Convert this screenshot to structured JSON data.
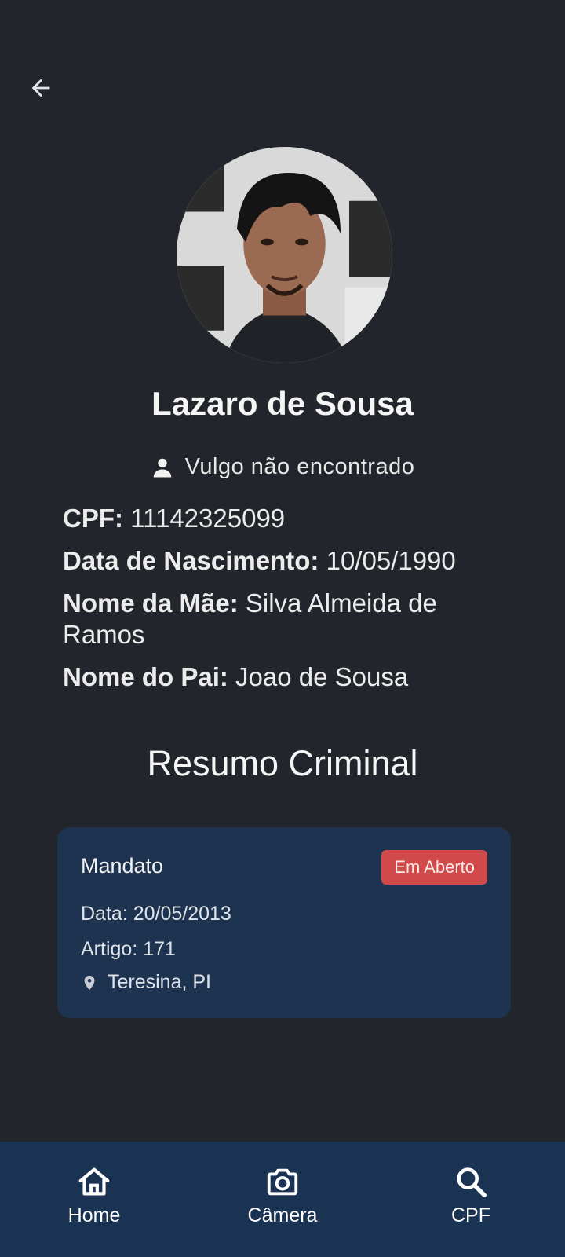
{
  "header": {
    "back_icon": "arrow-left-icon"
  },
  "profile": {
    "photo_icon": "profile-photo",
    "name": "Lazaro de Sousa",
    "nickname": "Vulgo não encontrado",
    "nickname_icon": "person-icon"
  },
  "details": [
    {
      "label": "CPF:",
      "value": " 11142325099"
    },
    {
      "label": "Data de Nascimento:",
      "value": " 10/05/1990"
    },
    {
      "label": "Nome da Mãe:",
      "value": " Silva Almeida de Ramos"
    },
    {
      "label": "Nome do Pai:",
      "value": " Joao de Sousa"
    }
  ],
  "summary": {
    "title": "Resumo Criminal",
    "records": [
      {
        "type": "Mandato",
        "status": "Em Aberto",
        "status_color": "#d04a4a",
        "date": "Data: 20/05/2013",
        "article": "Artigo: 171",
        "location": "Teresina, PI",
        "location_icon": "map-pin-icon"
      }
    ]
  },
  "nav": [
    {
      "label": "Home",
      "icon": "home-icon"
    },
    {
      "label": "Câmera",
      "icon": "camera-icon"
    },
    {
      "label": "CPF",
      "icon": "search-icon"
    }
  ],
  "colors": {
    "background": "#22252b",
    "card": "#1d3350",
    "nav_bar": "#1b3352",
    "badge": "#d04a4a"
  }
}
